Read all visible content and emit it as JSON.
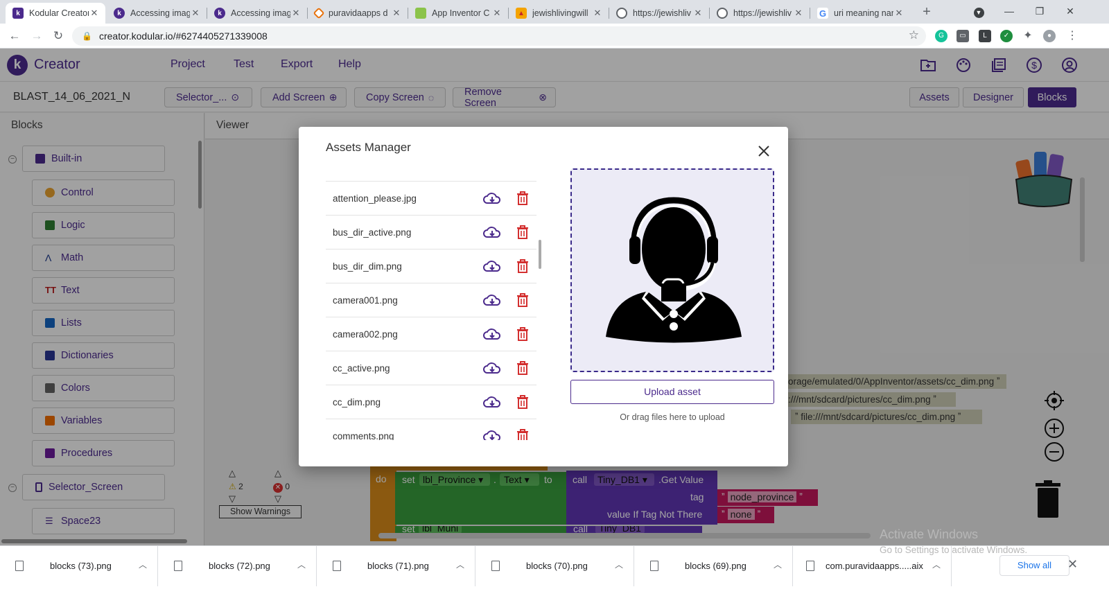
{
  "browser": {
    "tabs": [
      {
        "title": "Kodular Creator",
        "active": true,
        "favicon": "kodular-icon",
        "color": "#4b2a8c"
      },
      {
        "title": "Accessing imag",
        "active": false,
        "favicon": "kodular-icon",
        "color": "#4b2a8c"
      },
      {
        "title": "Accessing imag",
        "active": false,
        "favicon": "kodular-icon",
        "color": "#4b2a8c"
      },
      {
        "title": "puravidaapps d",
        "active": false,
        "favicon": "puravida-icon",
        "color": "#e8710a"
      },
      {
        "title": "App Inventor C",
        "active": false,
        "favicon": "appinventor-icon",
        "color": "#8bc34a"
      },
      {
        "title": "jewishlivingwill",
        "active": false,
        "favicon": "jewishliving-icon",
        "color": "#f4a300"
      },
      {
        "title": "https://jewishliv",
        "active": false,
        "favicon": "globe-icon",
        "color": "#5f6368"
      },
      {
        "title": "https://jewishliv",
        "active": false,
        "favicon": "globe-icon",
        "color": "#5f6368"
      },
      {
        "title": "uri meaning nan",
        "active": false,
        "favicon": "google-icon",
        "color": "#4285f4"
      }
    ],
    "url": "creator.kodular.io/#6274405271339008"
  },
  "app": {
    "logo_letter": "k",
    "logo_text": "Creator",
    "menu": [
      "Project",
      "Test",
      "Export",
      "Help"
    ],
    "project_name": "BLAST_14_06_2021_N",
    "screen_select": "Selector_...",
    "add_screen": "Add Screen",
    "copy_screen": "Copy Screen",
    "remove_screen": "Remove Screen",
    "view_buttons": [
      "Assets",
      "Designer",
      "Blocks"
    ],
    "accent_color": "#4b2a8c"
  },
  "blocks_panel": {
    "title": "Blocks",
    "builtin_label": "Built-in",
    "items": [
      {
        "label": "Control",
        "color": "#e6a02e"
      },
      {
        "label": "Logic",
        "color": "#2e7d32"
      },
      {
        "label": "Math",
        "color": "#1e3a8a"
      },
      {
        "label": "Text",
        "color": "#b71c1c"
      },
      {
        "label": "Lists",
        "color": "#1565c0"
      },
      {
        "label": "Dictionaries",
        "color": "#283593"
      },
      {
        "label": "Colors",
        "color": "#616161"
      },
      {
        "label": "Variables",
        "color": "#ef6c00"
      },
      {
        "label": "Procedures",
        "color": "#6a1b9a"
      }
    ],
    "screen_label": "Selector_Screen",
    "sub_item": "Space23"
  },
  "viewer": {
    "title": "Viewer",
    "warnings_count": "2",
    "errors_count": "0",
    "show_warnings": "Show Warnings",
    "strings": [
      "orage/emulated/0/AppInventor/assets/cc_dim.png",
      ":///mnt/sdcard/pictures/cc_dim.png",
      "file:///mnt/sdcard/pictures/cc_dim.png"
    ],
    "do_label": "do",
    "set_label": "set",
    "component": "lbl_Province",
    "property": "Text",
    "to_label": "to",
    "call_label": "call",
    "db_component": "Tiny_DB1",
    "get_value": ".Get Value",
    "tag_label": "tag",
    "tag_value": "node_province",
    "value_if_label": "value If Tag Not There",
    "value_if_value": "none",
    "row2_component": "lbl_Muni",
    "activate_title": "Activate Windows",
    "activate_sub": "Go to Settings to activate Windows."
  },
  "modal": {
    "title": "Assets Manager",
    "assets": [
      "attention_please.jpg",
      "bus_dir_active.png",
      "bus_dir_dim.png",
      "camera001.png",
      "camera002.png",
      "cc_active.png",
      "cc_dim.png",
      "comments.png"
    ],
    "upload_label": "Upload asset",
    "drag_text": "Or drag files here to upload",
    "preview_icon": "support-agent-icon"
  },
  "downloads": {
    "items": [
      "blocks (73).png",
      "blocks (72).png",
      "blocks (71).png",
      "blocks (70).png",
      "blocks (69).png",
      "com.puravidaapps.....aix"
    ],
    "show_all": "Show all"
  }
}
